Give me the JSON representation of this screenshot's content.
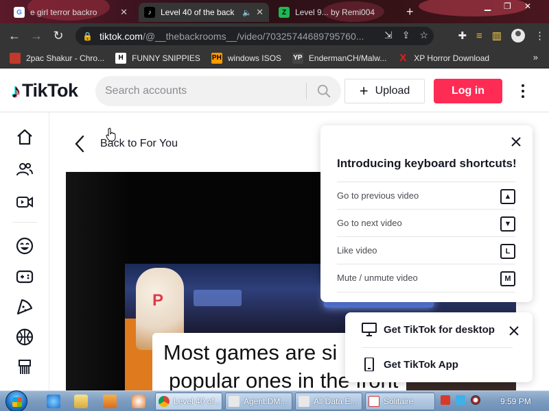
{
  "browser": {
    "tabs": [
      {
        "title": "e girl terror backro",
        "active": false
      },
      {
        "title": "Level 40 of the back",
        "active": true
      },
      {
        "title": "Level 9... by Remi004",
        "active": false
      }
    ],
    "url_host": "tiktok.com",
    "url_path": "/@__thebackrooms__/video/70325744689795760..."
  },
  "bookmarks": [
    {
      "label": "2pac Shakur - Chro...",
      "icon_text": "",
      "icon_color": "#c0392b"
    },
    {
      "label": "FUNNY SNIPPIES",
      "icon_text": "H",
      "icon_color": "#ffffff"
    },
    {
      "label": "windows ISOS",
      "icon_text": "PH",
      "icon_color": "#ff9900"
    },
    {
      "label": "EndermanCH/Malw...",
      "icon_text": "YP",
      "icon_color": "#444444"
    },
    {
      "label": "XP Horror Download",
      "icon_text": "X",
      "icon_color": "#e0201b"
    }
  ],
  "header": {
    "logo_text": "TikTok",
    "search_placeholder": "Search accounts",
    "upload_label": "Upload",
    "login_label": "Log in",
    "accent": "#fe2c55"
  },
  "sidebar": {
    "icons": [
      "home-icon",
      "following-icon",
      "live-icon",
      "comedy-icon",
      "gaming-icon",
      "food-icon",
      "sports-icon",
      "beauty-icon"
    ]
  },
  "main": {
    "back_label": "Back to For You",
    "caption_line1": "Most games are si",
    "caption_line2": "popular ones in the front"
  },
  "shortcuts": {
    "title": "Introducing keyboard shortcuts!",
    "items": [
      {
        "label": "Go to previous video",
        "key": "▲"
      },
      {
        "label": "Go to next video",
        "key": "▼"
      },
      {
        "label": "Like video",
        "key": "L"
      },
      {
        "label": "Mute / unmute video",
        "key": "M"
      }
    ]
  },
  "get_app": {
    "desktop_label": "Get TikTok for desktop",
    "app_label": "Get TikTok App"
  },
  "taskbar": {
    "tasks": [
      {
        "label": "Level 40 of...",
        "active": true
      },
      {
        "label": "Agent.DM...",
        "active": false
      },
      {
        "label": "All Data E...",
        "active": false
      },
      {
        "label": "Solitaire",
        "active": false
      }
    ],
    "clock": "9:59 PM"
  }
}
